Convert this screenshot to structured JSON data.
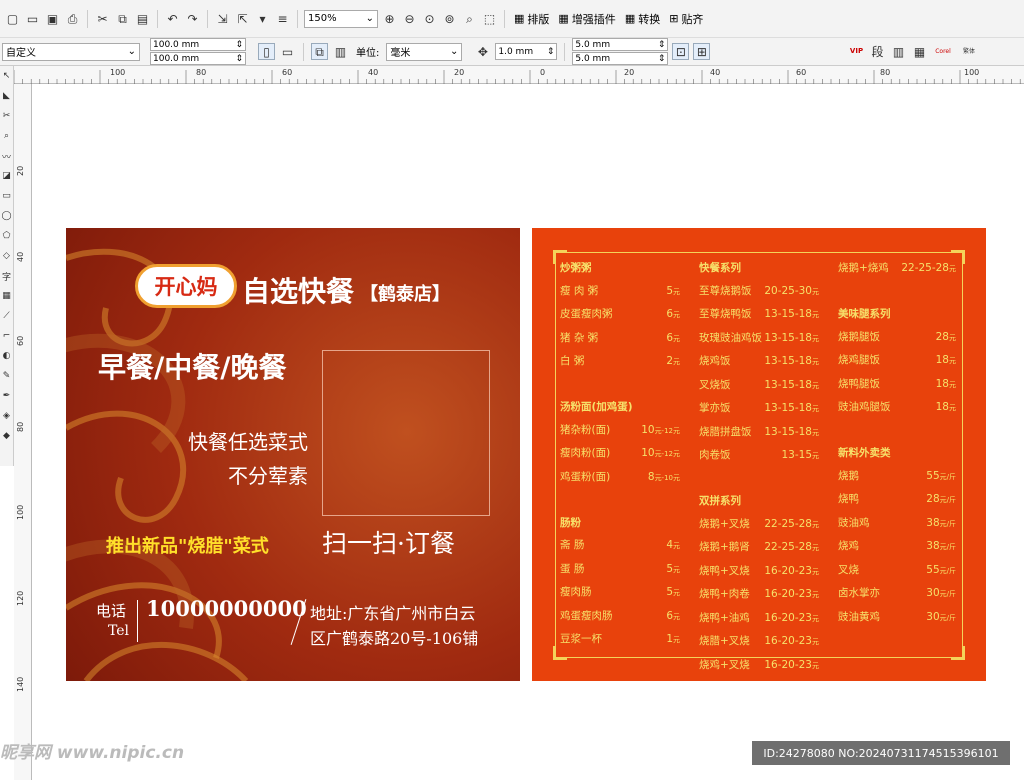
{
  "toolbar": {
    "zoom": "150%",
    "arrange": "排版",
    "plugin": "增强插件",
    "convert": "转换",
    "snap": "贴齐"
  },
  "propbar": {
    "preset": "自定义",
    "width": "100.0 mm",
    "height": "100.0 mm",
    "unit_label": "单位:",
    "unit": "毫米",
    "nudge": "1.0 mm",
    "dup_x": "5.0 mm",
    "dup_y": "5.0 mm",
    "vip": "VIP",
    "fixed": "段",
    "corel": "Corel",
    "fanti": "繁体"
  },
  "ruler": {
    "h": [
      "100",
      "80",
      "60",
      "40",
      "20",
      "0",
      "20",
      "40",
      "60",
      "80",
      "100"
    ],
    "v": [
      "20",
      "40",
      "60",
      "80",
      "100",
      "120",
      "140"
    ]
  },
  "card_front": {
    "brand": "开心妈",
    "title": "自选快餐",
    "branch": "【鹤泰店】",
    "meals": "早餐/中餐/晚餐",
    "line1": "快餐任选菜式",
    "line2": "不分荤素",
    "promo": "推出新品\"烧腊\"菜式",
    "scan": "扫一扫·订餐",
    "phone_label": "电话",
    "phone_en": "Tel",
    "phone": "10000000000",
    "addr1": "地址:广东省广州市白云",
    "addr2": "区广鹤泰路20号-106铺"
  },
  "card_back": {
    "col1": [
      {
        "h": "炒粥粥"
      },
      {
        "n": "瘦 肉 粥",
        "p": "5",
        "u": "元"
      },
      {
        "n": "皮蛋瘦肉粥",
        "p": "6",
        "u": "元"
      },
      {
        "n": "猪 杂 粥",
        "p": "6",
        "u": "元"
      },
      {
        "n": "白  粥",
        "p": "2",
        "u": "元"
      },
      {
        "gap": true
      },
      {
        "h": "汤粉面(加鸡蛋)"
      },
      {
        "n": "猪杂粉(面)",
        "p": "10",
        "u": "元-12元"
      },
      {
        "n": "瘦肉粉(面)",
        "p": "10",
        "u": "元-12元"
      },
      {
        "n": "鸡蛋粉(面)",
        "p": "8",
        "u": "元-10元"
      },
      {
        "gap": true
      },
      {
        "h": "肠粉"
      },
      {
        "n": "斋 肠",
        "p": "4",
        "u": "元"
      },
      {
        "n": "蛋 肠",
        "p": "5",
        "u": "元"
      },
      {
        "n": "瘦肉肠",
        "p": "5",
        "u": "元"
      },
      {
        "n": "鸡蛋瘦肉肠",
        "p": "6",
        "u": "元"
      },
      {
        "n": "豆浆一杯",
        "p": "1",
        "u": "元"
      }
    ],
    "col2": [
      {
        "h": "快餐系列"
      },
      {
        "n": "至尊烧鹅饭",
        "p": "20-25-30",
        "u": "元"
      },
      {
        "n": "至尊烧鸭饭",
        "p": "13-15-18",
        "u": "元"
      },
      {
        "n": "玫瑰豉油鸡饭",
        "p": "13-15-18",
        "u": "元"
      },
      {
        "n": "烧鸡饭",
        "p": "13-15-18",
        "u": "元"
      },
      {
        "n": "叉烧饭",
        "p": "13-15-18",
        "u": "元"
      },
      {
        "n": "掌亦饭",
        "p": "13-15-18",
        "u": "元"
      },
      {
        "n": "烧腊拼盘饭",
        "p": "13-15-18",
        "u": "元"
      },
      {
        "n": "肉卷饭",
        "p": "13-15",
        "u": "元"
      },
      {
        "gap": true
      },
      {
        "h": "双拼系列"
      },
      {
        "n": "烧鹅+叉烧",
        "p": "22-25-28",
        "u": "元"
      },
      {
        "n": "烧鹅+鹅肾",
        "p": "22-25-28",
        "u": "元"
      },
      {
        "n": "烧鸭+叉烧",
        "p": "16-20-23",
        "u": "元"
      },
      {
        "n": "烧鸭+肉卷",
        "p": "16-20-23",
        "u": "元"
      },
      {
        "n": "烧鸭+油鸡",
        "p": "16-20-23",
        "u": "元"
      },
      {
        "n": "烧腊+叉烧",
        "p": "16-20-23",
        "u": "元"
      },
      {
        "n": "烧鸡+叉烧",
        "p": "16-20-23",
        "u": "元"
      }
    ],
    "col3": [
      {
        "n": "烧鹅+烧鸡",
        "p": "22-25-28",
        "u": "元"
      },
      {
        "gap": true
      },
      {
        "h": "美味腿系列"
      },
      {
        "n": "烧鹅腿饭",
        "p": "28",
        "u": "元"
      },
      {
        "n": "烧鸡腿饭",
        "p": "18",
        "u": "元"
      },
      {
        "n": "烧鸭腿饭",
        "p": "18",
        "u": "元"
      },
      {
        "n": "豉油鸡腿饭",
        "p": "18",
        "u": "元"
      },
      {
        "gap": true
      },
      {
        "h": "新料外卖类"
      },
      {
        "n": "烧鹅",
        "p": "55",
        "u": "元/斤"
      },
      {
        "n": "烧鸭",
        "p": "28",
        "u": "元/斤"
      },
      {
        "n": "豉油鸡",
        "p": "38",
        "u": "元/斤"
      },
      {
        "n": "烧鸡",
        "p": "38",
        "u": "元/斤"
      },
      {
        "n": "叉烧",
        "p": "55",
        "u": "元/斤"
      },
      {
        "n": "卤水掌亦",
        "p": "30",
        "u": "元/斤"
      },
      {
        "n": "豉油黄鸡",
        "p": "30",
        "u": "元/斤"
      }
    ]
  },
  "watermark": "ID:24278080 NO:20240731174515396101",
  "site_logo": "昵享网 www.nipic.cn"
}
